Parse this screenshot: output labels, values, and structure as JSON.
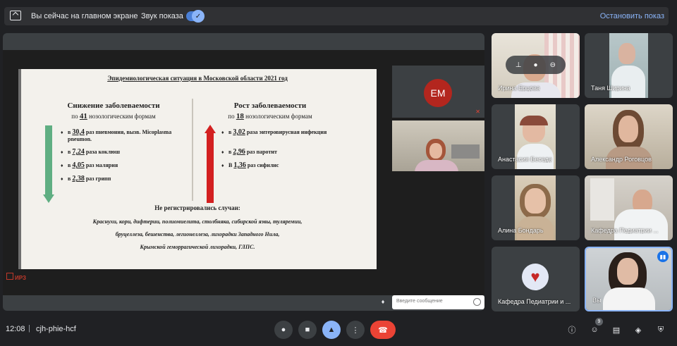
{
  "topbar": {
    "presenting_text": "Вы сейчас на главном экране",
    "sound_label": "Звук показа",
    "stop_label": "Остановить показ"
  },
  "slide": {
    "header": "Эпидемиологическая ситуация в Московской области 2021 год",
    "left": {
      "title": "Снижение заболеваемости",
      "sub_pre": "по",
      "sub_num": "41",
      "sub_post": "нозологическим формам",
      "items": [
        {
          "pre": "в",
          "num": "30,4",
          "post": "раз пневмония, вызв. Micoplasma pneumon."
        },
        {
          "pre": "в",
          "num": "7,24",
          "post": "раза коклюш"
        },
        {
          "pre": "в",
          "num": "4,05",
          "post": "раз малярия"
        },
        {
          "pre": "в",
          "num": "2,38",
          "post": "раз грипп"
        }
      ]
    },
    "right": {
      "title": "Рост заболеваемости",
      "sub_pre": "по",
      "sub_num": "18",
      "sub_post": "нозологическим формам",
      "items": [
        {
          "pre": "в",
          "num": "3,02",
          "post": "раза энтеровирусная инфекция"
        },
        {
          "pre": "в",
          "num": "2,96",
          "post": "раз паротит"
        },
        {
          "pre": "В",
          "num": "1,36",
          "post": "раз сифилис"
        }
      ]
    },
    "not_registered_title": "Не регистрировались случаи:",
    "not_registered_lines": [
      "Краснухи, кори, дифтерии, полиомиелита, столбняка, сибирской язвы, туляремии,",
      "бруцеллеза, бешенства, легионеллеза, лихорадки Западного Нила,",
      "Крымской геморрагической лихорадки, ГЛПС."
    ],
    "logo_text": "ИРЗ"
  },
  "side": {
    "em_initials": "EM",
    "chat_placeholder": "Введите сообщение"
  },
  "participants": [
    {
      "name": "Ирина Ерцова"
    },
    {
      "name": "Таня Ширина"
    },
    {
      "name": "Анастасия Беседа"
    },
    {
      "name": "Александр Роговцов"
    },
    {
      "name": "Алина Бондарь"
    },
    {
      "name": "Кафедра Педиатрии ..."
    },
    {
      "name": "Кафедра Педиатрии и ..."
    },
    {
      "name": "Вы"
    }
  ],
  "bottombar": {
    "time": "12:08",
    "separator": "|",
    "meeting_code": "cjh-phie-hcf",
    "participants_count": "9"
  },
  "colors": {
    "accent": "#8ab4f8",
    "leave": "#ea4335",
    "down_arrow": "#5fae82",
    "up_arrow": "#d32020"
  }
}
